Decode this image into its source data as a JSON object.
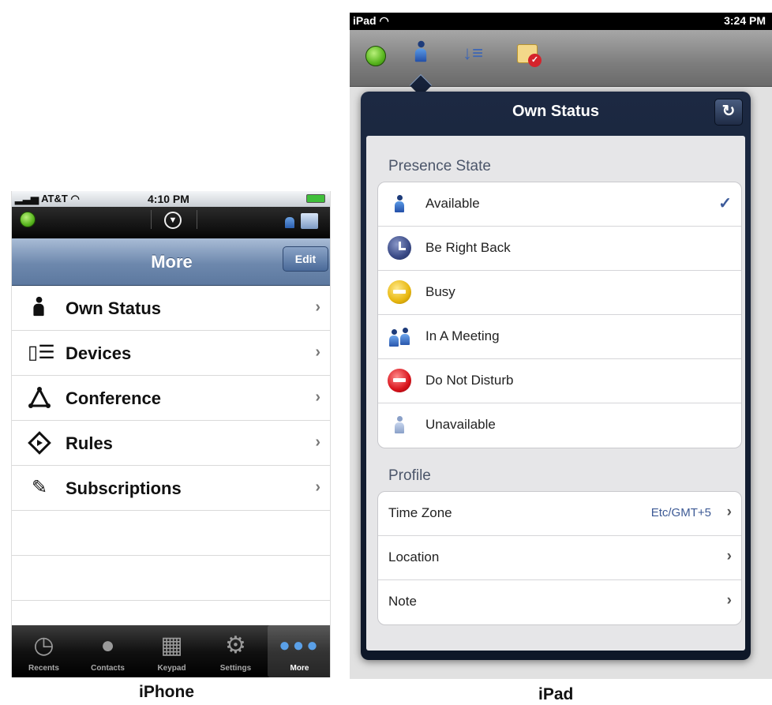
{
  "iphone": {
    "status_bar": {
      "carrier": "AT&T",
      "time": "4:10 PM"
    },
    "nav": {
      "title": "More",
      "edit_label": "Edit"
    },
    "menu_items": [
      {
        "label": "Own Status",
        "icon": "person-icon"
      },
      {
        "label": "Devices",
        "icon": "devices-icon"
      },
      {
        "label": "Conference",
        "icon": "conference-icon"
      },
      {
        "label": "Rules",
        "icon": "rules-icon"
      },
      {
        "label": "Subscriptions",
        "icon": "subscriptions-icon"
      }
    ],
    "tabs": [
      {
        "label": "Recents",
        "icon": "clock-icon"
      },
      {
        "label": "Contacts",
        "icon": "contact-icon"
      },
      {
        "label": "Keypad",
        "icon": "keypad-icon"
      },
      {
        "label": "Settings",
        "icon": "gears-icon"
      },
      {
        "label": "More",
        "icon": "more-icon",
        "active": true
      }
    ],
    "caption": "iPhone"
  },
  "ipad": {
    "status_bar": {
      "device": "iPad",
      "time": "3:24 PM"
    },
    "popover": {
      "title": "Own Status",
      "presence_header": "Presence State",
      "presence_states": [
        {
          "label": "Available",
          "icon": "available-icon",
          "selected": true
        },
        {
          "label": "Be Right Back",
          "icon": "be-right-back-icon"
        },
        {
          "label": "Busy",
          "icon": "busy-icon"
        },
        {
          "label": "In A Meeting",
          "icon": "in-a-meeting-icon"
        },
        {
          "label": "Do Not Disturb",
          "icon": "do-not-disturb-icon"
        },
        {
          "label": "Unavailable",
          "icon": "unavailable-icon"
        }
      ],
      "profile_header": "Profile",
      "profile_items": [
        {
          "label": "Time Zone",
          "value": "Etc/GMT+5"
        },
        {
          "label": "Location",
          "value": ""
        },
        {
          "label": "Note",
          "value": ""
        }
      ]
    },
    "caption": "iPad"
  },
  "colors": {
    "presence_available": "#58b51e",
    "nav_blue": "#6d88ad",
    "popover_dark": "#16223a",
    "checkmark": "#3c5a9a"
  }
}
